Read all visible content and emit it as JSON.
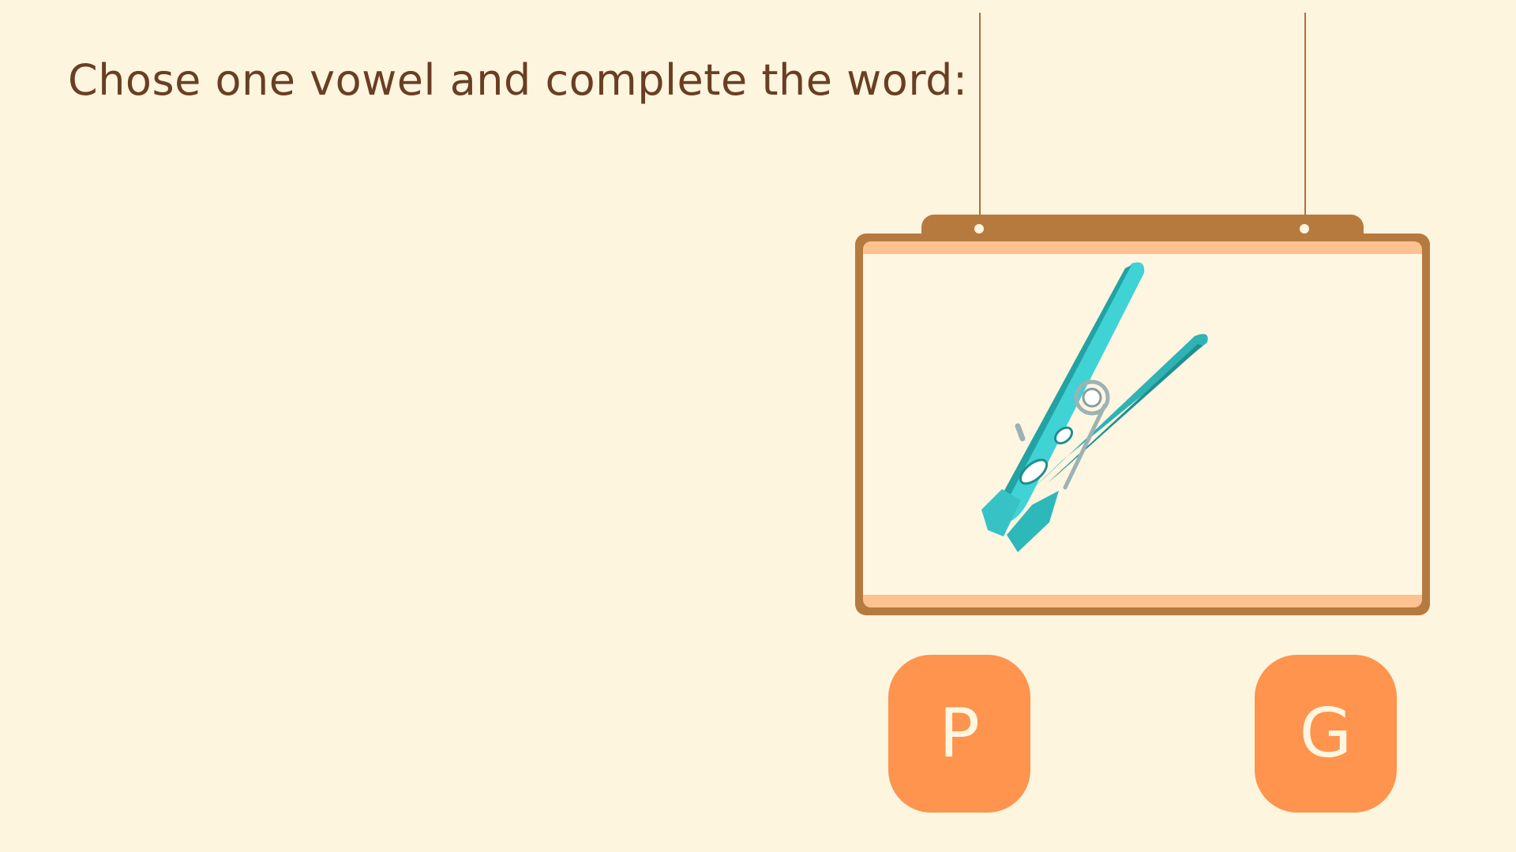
{
  "instruction": "Chose one vowel and complete the word:",
  "board": {
    "picture_icon": "clothespin-icon"
  },
  "options": [
    {
      "label": "P"
    },
    {
      "label": "G"
    }
  ],
  "colors": {
    "background": "#FEF5DF",
    "instruction_text": "#6A3E22",
    "board_frame": "#B67A3F",
    "board_stripe": "#FEC291",
    "board_surface": "#FFF6E1",
    "button_fill": "#FE944D",
    "button_text": "#FFF6E1",
    "clothespin": "#3BC9CC"
  }
}
